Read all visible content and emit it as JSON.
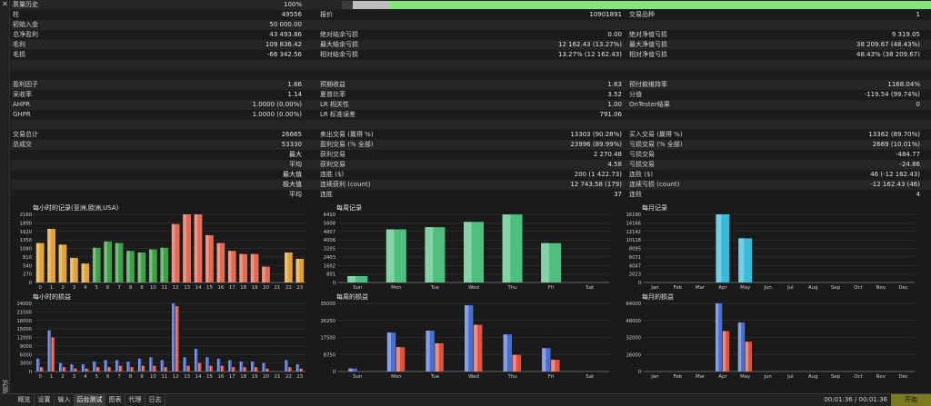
{
  "window": {
    "close_glyph": "✕",
    "vertical_label": "策略测试"
  },
  "stats": {
    "quality": {
      "label": "质量历史",
      "value": "100%",
      "bar_fraction": 1.0
    },
    "rows": [
      {
        "l1": "柱",
        "v1": "49556",
        "l2": "报价",
        "v2": "10901891",
        "l3": "交易品种",
        "v3": "1"
      },
      {
        "l1": "初始入金",
        "v1": "50 000.00",
        "l2": "",
        "v2": "",
        "l3": "",
        "v3": ""
      },
      {
        "l1": "总净盈利",
        "v1": "43 493.86",
        "l2": "绝对结余亏损",
        "v2": "0.00",
        "l3": "绝对净值亏损",
        "v3": "9 319.05"
      },
      {
        "l1": "毛利",
        "v1": "109 836.42",
        "l2": "最大结余亏损",
        "v2": "12 162.43 (13.27%)",
        "l3": "最大净值亏损",
        "v3": "38 209.67 (48.43%)"
      },
      {
        "l1": "毛损",
        "v1": "-66 342.56",
        "l2": "相对结余亏损",
        "v2": "13.27% (12 162.43)",
        "l3": "相对净值亏损",
        "v3": "48.43% (38 209.67)"
      },
      {
        "l1": "",
        "v1": "",
        "l2": "",
        "v2": "",
        "l3": "",
        "v3": ""
      },
      {
        "l1": "",
        "v1": "",
        "l2": "",
        "v2": "",
        "l3": "",
        "v3": ""
      },
      {
        "l1": "盈利因子",
        "v1": "1.66",
        "l2": "预期收益",
        "v2": "1.63",
        "l3": "预付款维持率",
        "v3": "1168.04%"
      },
      {
        "l1": "采收率",
        "v1": "1.14",
        "l2": "夏普比率",
        "v2": "3.52",
        "l3": "分值",
        "v3": "-119.54 (99.74%)"
      },
      {
        "l1": "AHPR",
        "v1": "1.0000 (0.00%)",
        "l2": "LR 相关性",
        "v2": "1.00",
        "l3": "OnTester结果",
        "v3": "0"
      },
      {
        "l1": "GHPR",
        "v1": "1.0000 (0.00%)",
        "l2": "LR 标准误差",
        "v2": "791.06",
        "l3": "",
        "v3": ""
      },
      {
        "l1": "",
        "v1": "",
        "l2": "",
        "v2": "",
        "l3": "",
        "v3": ""
      },
      {
        "l1": "交易总计",
        "v1": "26665",
        "l2": "卖出交易 (赢得 %)",
        "v2": "13303 (90.28%)",
        "l3": "买入交易 (赢得 %)",
        "v3": "13362 (89.70%)"
      },
      {
        "l1": "总成交",
        "v1": "53330",
        "l2": "盈利交易 (% 全部)",
        "v2": "23996 (89.99%)",
        "l3": "亏损交易 (% 全部)",
        "v3": "2669 (10.01%)"
      },
      {
        "l1": "",
        "v1": "最大",
        "l2": "获利交易",
        "v2": "2 270.48",
        "l3": "亏损交易",
        "v3": "-484.77"
      },
      {
        "l1": "",
        "v1": "平均",
        "l2": "获利交易",
        "v2": "4.58",
        "l3": "亏损交易",
        "v3": "-24.86"
      },
      {
        "l1": "",
        "v1": "最大值",
        "l2": "连胜 ($)",
        "v2": "200 (1 422.73)",
        "l3": "连败 ($)",
        "v3": "46 (-12 162.43)"
      },
      {
        "l1": "",
        "v1": "极大值",
        "l2": "连续获利 (count)",
        "v2": "12 743.58 (179)",
        "l3": "连续亏损 (count)",
        "v3": "-12 162.43 (46)"
      },
      {
        "l1": "",
        "v1": "平均",
        "l2": "连胜",
        "v2": "37",
        "l3": "连败",
        "v3": "4"
      }
    ]
  },
  "chart_data": [
    {
      "type": "bar",
      "title": "每小时的记录(亚洲,欧洲,USA)",
      "categories": [
        "0",
        "1",
        "2",
        "3",
        "4",
        "5",
        "6",
        "7",
        "8",
        "9",
        "10",
        "11",
        "12",
        "13",
        "14",
        "15",
        "16",
        "17",
        "18",
        "19",
        "20",
        "21",
        "22",
        "23"
      ],
      "yticks": [
        "0",
        "270",
        "540",
        "810",
        "1080",
        "1350",
        "1620",
        "1890",
        "2160"
      ],
      "ylim": [
        0,
        2160
      ],
      "values": [
        1250,
        1700,
        1200,
        780,
        600,
        1100,
        1300,
        1250,
        1000,
        950,
        1050,
        1100,
        1850,
        2160,
        2160,
        1500,
        1250,
        1000,
        900,
        900,
        500,
        0,
        950,
        750
      ],
      "colors_per_bar": [
        "#e0a23a",
        "#e0a23a",
        "#e0a23a",
        "#e0a23a",
        "#e0a23a",
        "#3fa048",
        "#3fa048",
        "#3fa048",
        "#3fa048",
        "#3fa048",
        "#3fa048",
        "#3fa048",
        "#e36a55",
        "#e36a55",
        "#e36a55",
        "#e36a55",
        "#e36a55",
        "#e36a55",
        "#e36a55",
        "#e36a55",
        "#e36a55",
        "#e36a55",
        "#e0a23a",
        "#e0a23a"
      ]
    },
    {
      "type": "bar",
      "title": "每周记录",
      "categories": [
        "Sun",
        "Mon",
        "Tue",
        "Wed",
        "Thu",
        "Fri",
        "Sat"
      ],
      "yticks": [
        "0",
        "801",
        "1602",
        "2403",
        "3205",
        "4006",
        "4807",
        "5608",
        "6410"
      ],
      "ylim": [
        0,
        6410
      ],
      "values": [
        600,
        5000,
        5200,
        5700,
        6400,
        3700,
        0
      ],
      "color": "#4fbf7f"
    },
    {
      "type": "bar",
      "title": "每月记录",
      "categories": [
        "Jan",
        "Feb",
        "Mar",
        "Apr",
        "May",
        "Jun",
        "Jul",
        "Aug",
        "Sep",
        "Oct",
        "Nov",
        "Dec"
      ],
      "yticks": [
        "0",
        "2023",
        "4047",
        "6071",
        "8095",
        "10118",
        "12142",
        "14166",
        "16190"
      ],
      "ylim": [
        0,
        16190
      ],
      "values": [
        0,
        0,
        0,
        16190,
        10500,
        0,
        0,
        0,
        0,
        0,
        0,
        0
      ],
      "color": "#3ab9d8"
    },
    {
      "type": "bar",
      "title": "每小时的损益",
      "categories": [
        "0",
        "1",
        "2",
        "3",
        "4",
        "5",
        "6",
        "7",
        "8",
        "9",
        "10",
        "11",
        "12",
        "13",
        "14",
        "15",
        "16",
        "17",
        "18",
        "19",
        "20",
        "21",
        "22",
        "23"
      ],
      "yticks": [
        "0",
        "3000",
        "6000",
        "9000",
        "12000",
        "15000",
        "18000",
        "21000",
        "24000"
      ],
      "ylim": [
        0,
        24000
      ],
      "series": [
        {
          "name": "",
          "color": "#4a6fd0",
          "values": [
            4500,
            14500,
            3000,
            2500,
            2500,
            3500,
            4000,
            4000,
            3500,
            4500,
            5000,
            4000,
            24000,
            5000,
            8000,
            5000,
            4500,
            4000,
            3500,
            3500,
            3000,
            0,
            4000,
            2500
          ]
        },
        {
          "name": "",
          "color": "#e0503a",
          "values": [
            1500,
            12000,
            1500,
            1000,
            1000,
            1500,
            1500,
            2000,
            1500,
            2000,
            2000,
            1500,
            23000,
            2000,
            3000,
            2000,
            2000,
            1500,
            1500,
            1500,
            1000,
            0,
            1500,
            1000
          ]
        }
      ]
    },
    {
      "type": "bar",
      "title": "每周的损益",
      "categories": [
        "Sun",
        "Mon",
        "Tue",
        "Wed",
        "Thu",
        "Fri",
        "Sat"
      ],
      "yticks": [
        "0",
        "8750",
        "17500",
        "26250",
        "35000"
      ],
      "ylim": [
        0,
        35000
      ],
      "series": [
        {
          "name": "",
          "color": "#4a6fd0",
          "values": [
            1500,
            20000,
            21000,
            34000,
            19000,
            12000,
            0
          ]
        },
        {
          "name": "",
          "color": "#e0503a",
          "values": [
            0,
            12500,
            14500,
            24000,
            8500,
            6000,
            0
          ]
        }
      ]
    },
    {
      "type": "bar",
      "title": "每月的损益",
      "categories": [
        "Jan",
        "Feb",
        "Mar",
        "Apr",
        "May",
        "Jun",
        "Jul",
        "Aug",
        "Sep",
        "Oct",
        "Nov",
        "Dec"
      ],
      "yticks": [
        "0",
        "16000",
        "32000",
        "48000",
        "64000"
      ],
      "ylim": [
        0,
        64000
      ],
      "series": [
        {
          "name": "",
          "color": "#4a6fd0",
          "values": [
            0,
            0,
            0,
            64000,
            46000,
            0,
            0,
            0,
            0,
            0,
            0,
            0
          ]
        },
        {
          "name": "",
          "color": "#e0503a",
          "values": [
            0,
            0,
            0,
            38000,
            28000,
            0,
            0,
            0,
            0,
            0,
            0,
            0
          ]
        }
      ]
    }
  ],
  "bottombar": {
    "tabs": [
      "概览",
      "设置",
      "输入",
      "后台测试",
      "图表",
      "代理",
      "日志"
    ],
    "active_tab": 3,
    "timer": "00:01:36 / 00:01:36",
    "start_label": "开始"
  }
}
